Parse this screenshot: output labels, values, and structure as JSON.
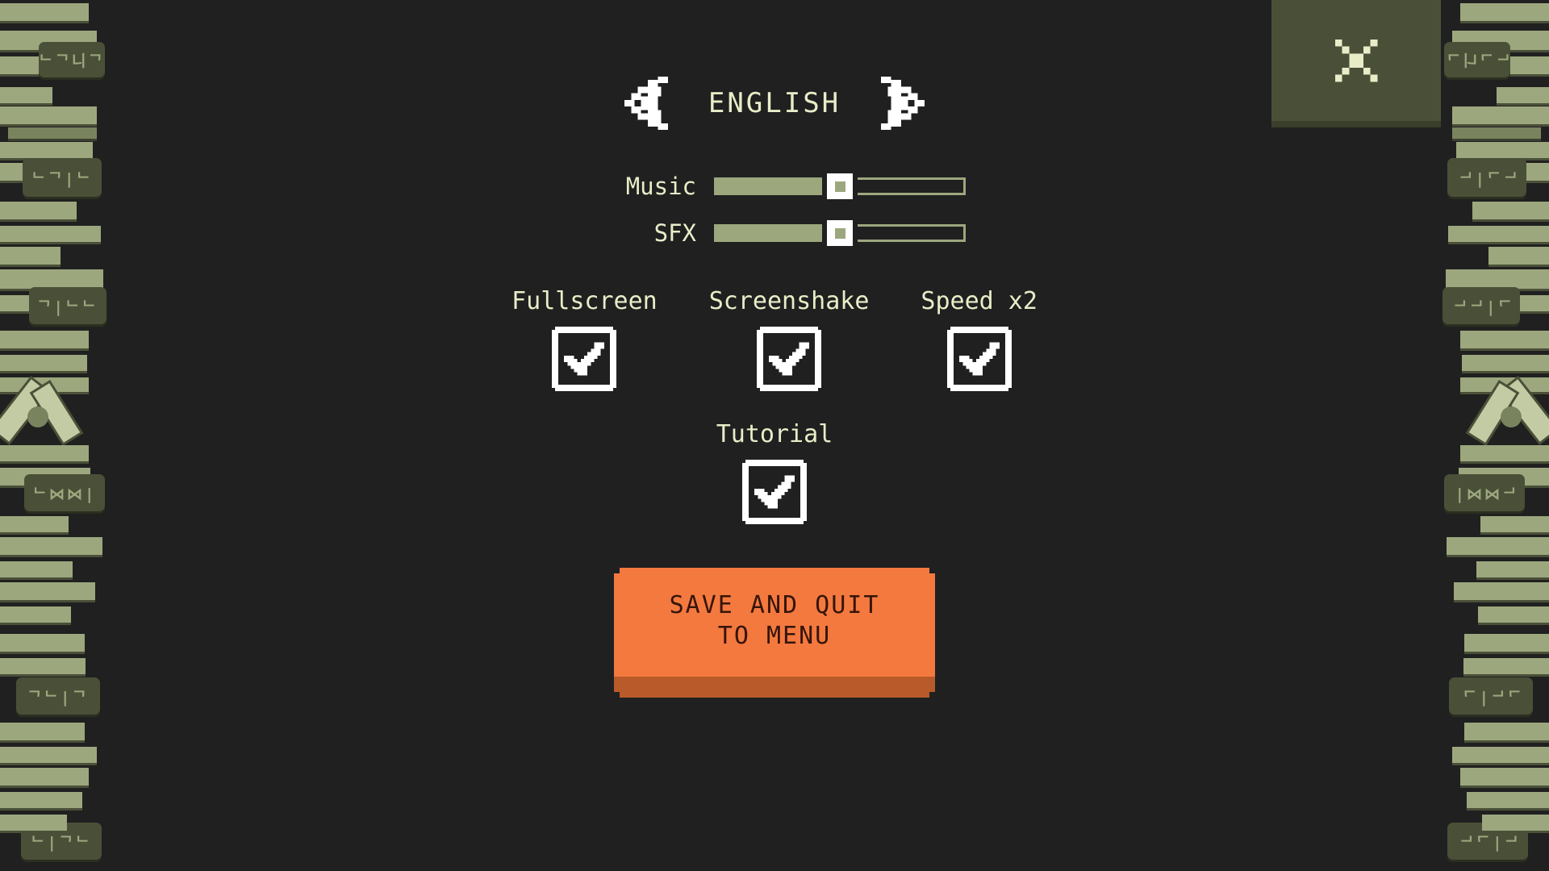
{
  "background_color": "#202020",
  "accent_colors": {
    "text_cream": "#e8edc8",
    "olive": "#9ca77e",
    "olive_dark": "#4a5038",
    "button_orange": "#f4793f",
    "button_shadow": "#b85a2a",
    "button_text": "#35150a",
    "white": "#ffffff"
  },
  "close_button": {
    "icon": "close-x-icon",
    "label": "Close"
  },
  "language": {
    "prev_icon": "chevron-left-icon",
    "next_icon": "chevron-right-icon",
    "selected": "ENGLISH"
  },
  "sliders": [
    {
      "label": "Music",
      "value": 50,
      "min": 0,
      "max": 100
    },
    {
      "label": "SFX",
      "value": 50,
      "min": 0,
      "max": 100
    }
  ],
  "checkboxes_row1": [
    {
      "label": "Fullscreen",
      "checked": true
    },
    {
      "label": "Screenshake",
      "checked": true
    },
    {
      "label": "Speed x2",
      "checked": true
    }
  ],
  "checkboxes_row2": [
    {
      "label": "Tutorial",
      "checked": true
    }
  ],
  "save_button": {
    "line1": "SAVE AND QUIT",
    "line2": "TO MENU"
  }
}
